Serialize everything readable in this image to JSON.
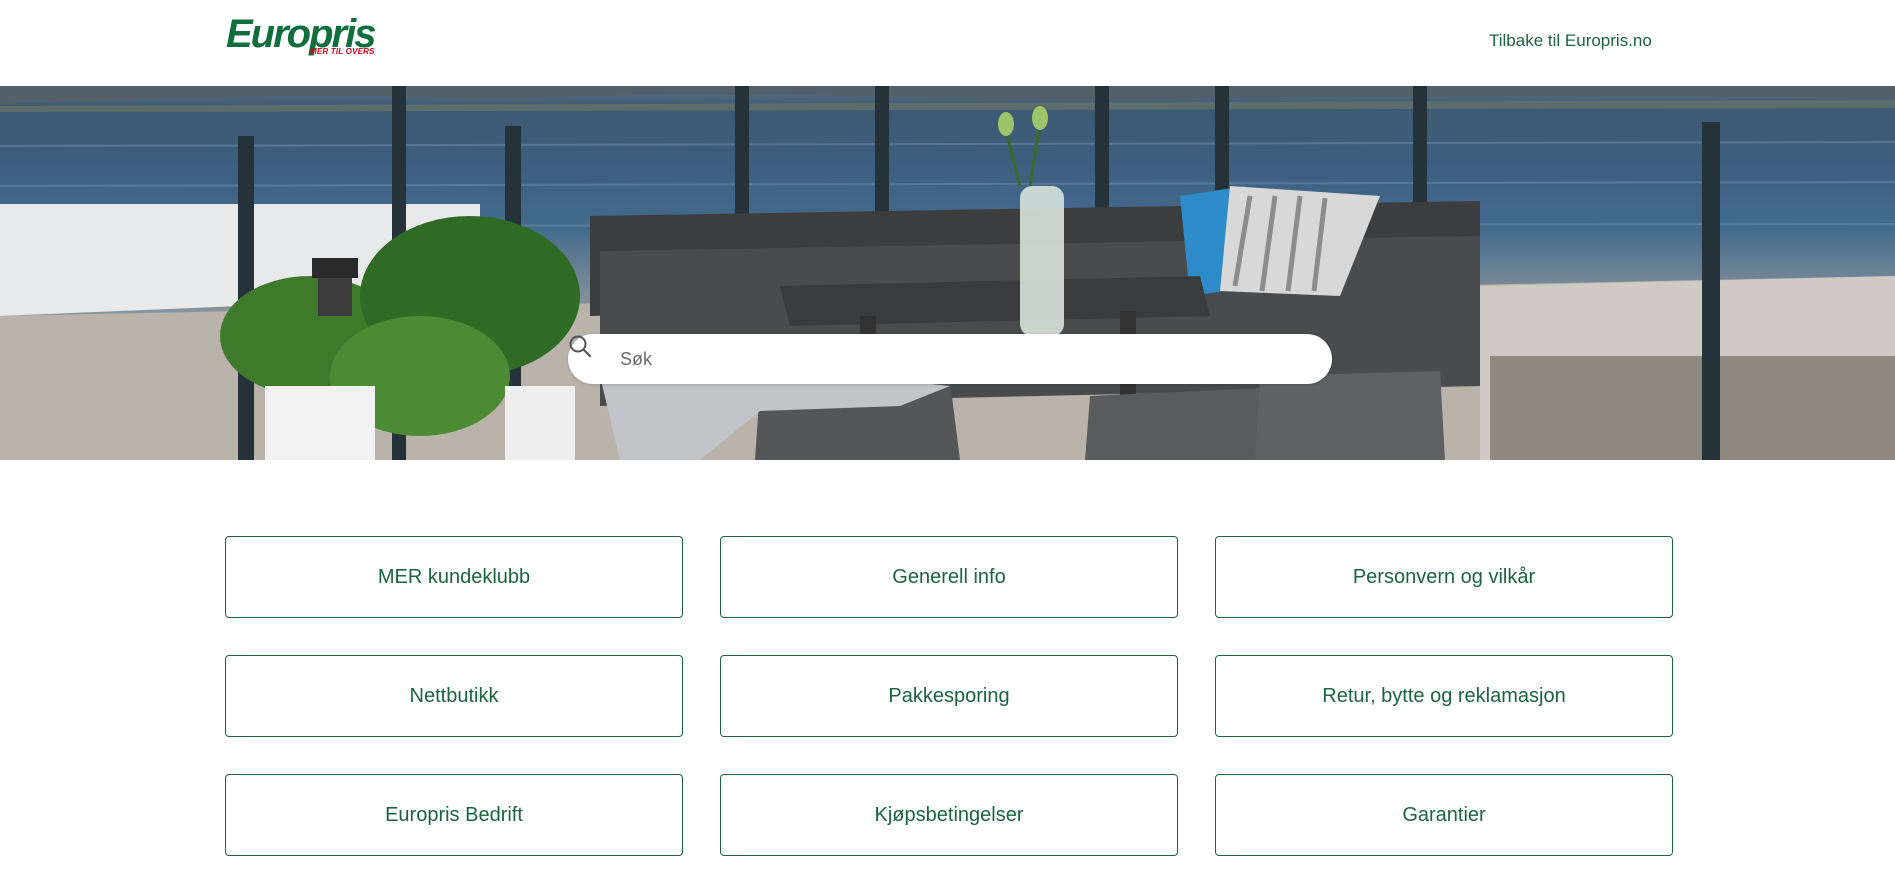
{
  "header": {
    "logo_text": "Europris",
    "logo_tagline": "MER TIL OVERS",
    "back_link": "Tilbake til Europris.no"
  },
  "search": {
    "placeholder": "Søk"
  },
  "categories": [
    {
      "label": "MER kundeklubb"
    },
    {
      "label": "Generell info"
    },
    {
      "label": "Personvern og vilkår"
    },
    {
      "label": "Nettbutikk"
    },
    {
      "label": "Pakkesporing"
    },
    {
      "label": "Retur, bytte og reklamasjon"
    },
    {
      "label": "Europris Bedrift"
    },
    {
      "label": "Kjøpsbetingelser"
    },
    {
      "label": "Garantier"
    }
  ],
  "colors": {
    "brand_green": "#0f6e3b",
    "link_green": "#1b6343",
    "brand_red": "#d0021b"
  }
}
